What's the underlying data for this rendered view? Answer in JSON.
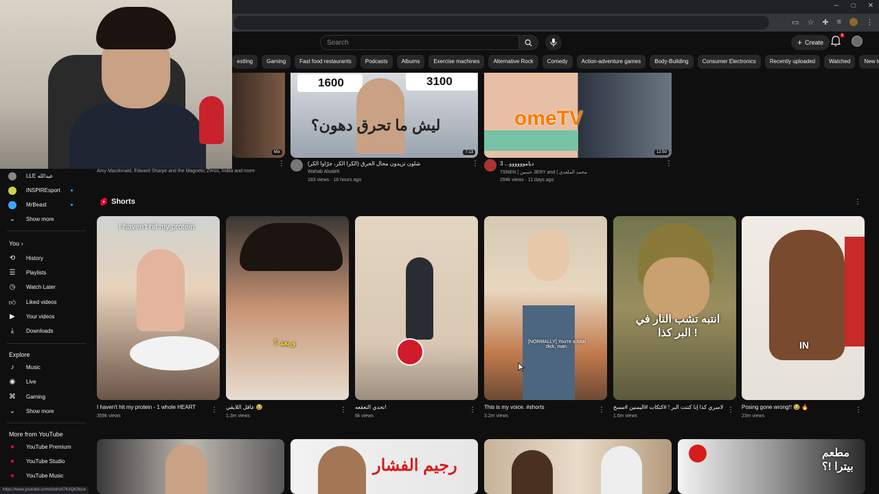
{
  "browser": {
    "window_controls": [
      "─",
      "□",
      "✕"
    ]
  },
  "topbar": {
    "search_placeholder": "Search",
    "create_label": "Create",
    "notification_count": "9"
  },
  "chips": [
    "estling",
    "Gaming",
    "Fast food restaurants",
    "Podcasts",
    "Albums",
    "Exercise machines",
    "Alternative Rock",
    "Comedy",
    "Action-adventure games",
    "Body-Building",
    "Consumer Electronics",
    "Recently uploaded",
    "Watched",
    "New to you"
  ],
  "sidebar": {
    "channels": [
      {
        "name": "LLE عبدالله"
      },
      {
        "name": "INSPIREsport"
      },
      {
        "name": "MrBeast"
      }
    ],
    "show_more": "Show more",
    "you_label": "You",
    "you_items": [
      "History",
      "Playlists",
      "Watch Later",
      "Liked videos",
      "Your videos",
      "Downloads"
    ],
    "explore_label": "Explore",
    "explore_items": [
      "Music",
      "Live",
      "Gaming"
    ],
    "show_more_2": "Show more",
    "more_label": "More from YouTube",
    "more_items": [
      "YouTube Premium",
      "YouTube Studio",
      "YouTube Music"
    ]
  },
  "top_videos": [
    {
      "channel": "Amy Macdonald, Edward Sharpe and the Magnetic Zeros, Indila and more",
      "badge": "Mix"
    },
    {
      "title": "شلون تزيدون محال الحرق (الكرا الكر، جرّاوا الكر)",
      "channel": "Wahab Alsaleh",
      "meta": "183 views · 16 hours ago",
      "duration": "7:13",
      "overlay": "ليش ما تحرق دهون؟",
      "num1": "1600",
      "num2": "3100"
    },
    {
      "title": "3 ...دياموووووو",
      "channel": "7SNEN | حسين JERY and | محمد الملعدي",
      "meta": "294k views · 11 days ago",
      "duration": "12:50",
      "overlay": "omeTV"
    }
  ],
  "shorts": {
    "heading": "Shorts",
    "items": [
      {
        "title": "I haven't hit my protein - 1 whole HEART",
        "views": "359k views",
        "overlay": "I haven't hit my protein"
      },
      {
        "title": "عاقل اللايقي 😂",
        "views": "1.3m views",
        "overlay": "و بعد ؟"
      },
      {
        "title": "تحدي التعقعه!",
        "views": "6k views",
        "overlay": ""
      },
      {
        "title": "This is my voice.  #shorts",
        "views": "3.2m views",
        "overlay": "[NORMALLY] You're a total dick, man."
      },
      {
        "title": "لاسري كذا إنا كنتت البر ! #كتكات #اليمنين #مسخ",
        "views": "1.6m views",
        "overlay": "انتبه تشب النار في البر كذا !"
      },
      {
        "title": "Posing gone wrong!! 😂 🔥",
        "views": "23m views",
        "overlay": "IN"
      }
    ]
  },
  "bottom_videos": [
    {
      "overlay": ""
    },
    {
      "overlay": "رجيم الفشار"
    },
    {
      "overlay": ""
    },
    {
      "overlay": "مطعم بيترا !؟"
    }
  ],
  "status_url": "https://www.youtube.com/shorts/t7KdQk0b1w"
}
